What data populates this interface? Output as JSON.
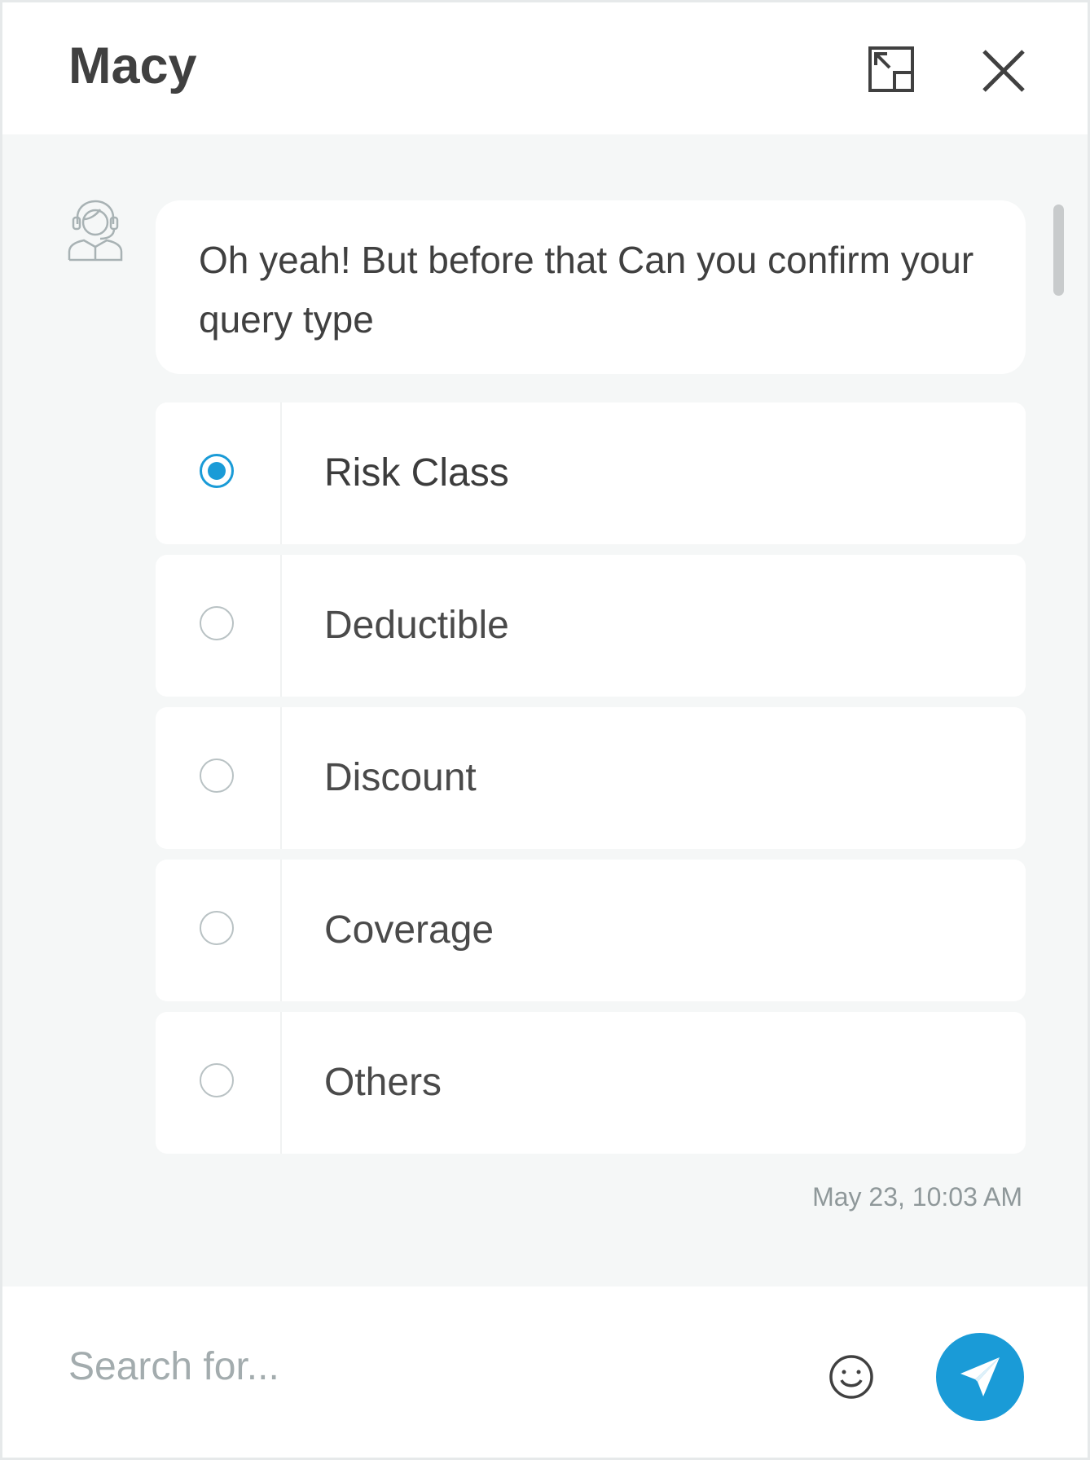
{
  "header": {
    "title": "Macy"
  },
  "message": {
    "text": "Oh yeah!  But before that Can you confirm your query type",
    "timestamp": "May 23, 10:03 AM"
  },
  "options": [
    {
      "label": "Risk Class",
      "selected": true
    },
    {
      "label": "Deductible",
      "selected": false
    },
    {
      "label": "Discount",
      "selected": false
    },
    {
      "label": "Coverage",
      "selected": false
    },
    {
      "label": "Others",
      "selected": false
    }
  ],
  "footer": {
    "search_placeholder": "Search for..."
  },
  "colors": {
    "accent": "#1a9bd7",
    "text": "#404040",
    "panel_bg": "#f5f7f7"
  }
}
